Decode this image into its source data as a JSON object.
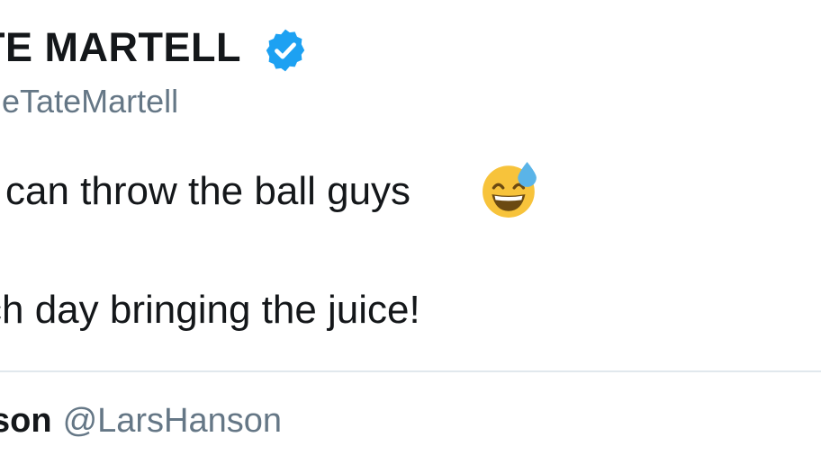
{
  "tweet": {
    "display_name": "TE MARTELL",
    "handle": "neTateMartell",
    "text_line_1": "i can throw the ball guys",
    "text_line_2": "ch day bringing the juice!",
    "emoji": "grinning-face-with-sweat",
    "verified": true
  },
  "quoted": {
    "name": "son",
    "handle": "@LarsHanson"
  },
  "colors": {
    "text": "#14171a",
    "secondary": "#657786",
    "verified_blue": "#1da1f2",
    "divider": "#e1e8ed",
    "emoji_yellow": "#f7c33b",
    "sweat_blue": "#5ab4e8"
  }
}
